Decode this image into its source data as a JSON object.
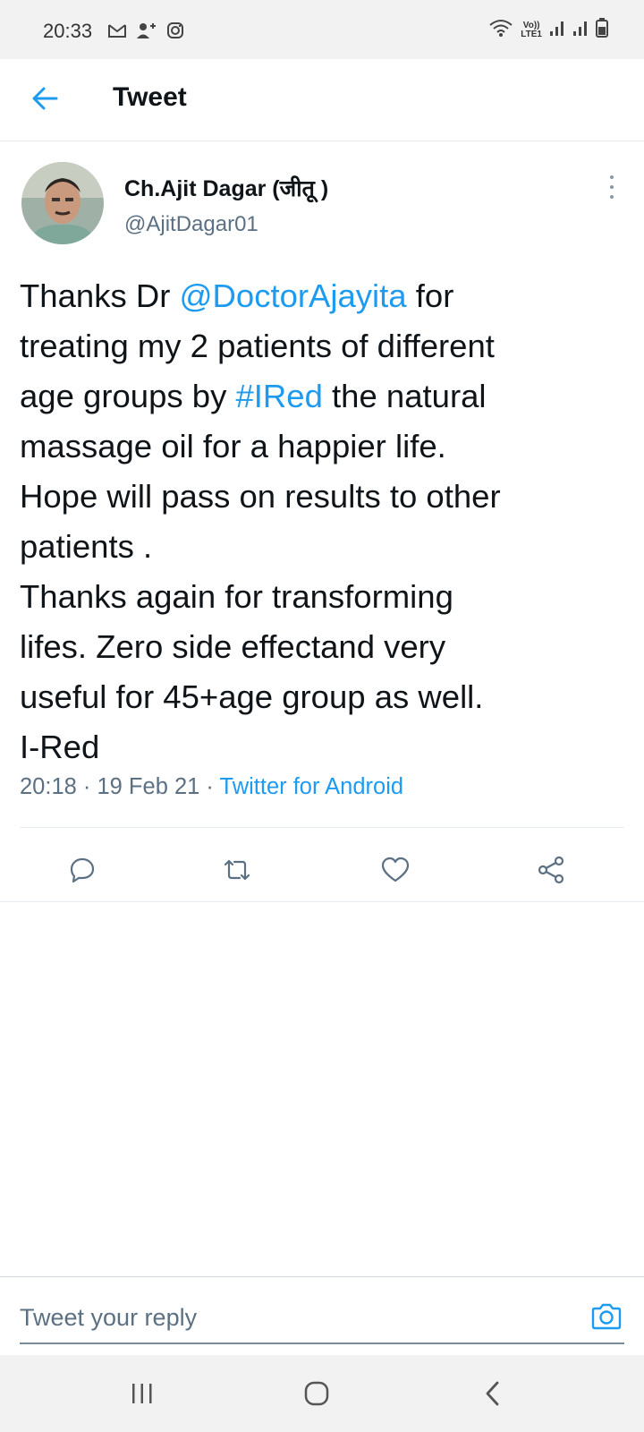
{
  "status_bar": {
    "time": "20:33",
    "left_icons": [
      "gmail-icon",
      "add-contact-icon",
      "instagram-icon"
    ],
    "volte_label": "Vo))\nLTE1",
    "right_icons": [
      "wifi-icon",
      "signal-icon",
      "signal-icon",
      "battery-icon"
    ]
  },
  "header": {
    "title": "Tweet",
    "back_icon": "back-arrow-icon"
  },
  "tweet": {
    "author_name": "Ch.Ajit Dagar (जीतू )",
    "author_handle": "@AjitDagar01",
    "text_parts": [
      {
        "text": "Thanks Dr ",
        "type": "plain"
      },
      {
        "text": "@DoctorAjayita",
        "type": "mention"
      },
      {
        "text": " for\ntreating my 2 patients of different\nage groups by ",
        "type": "plain"
      },
      {
        "text": "#IRed",
        "type": "hashtag"
      },
      {
        "text": " the natural\nmassage oil for a happier life.\nHope will pass on results to other\npatients .\nThanks again for transforming\nlifes. Zero side effectand very\nuseful for 45+age group as well.\nI-Red",
        "type": "plain"
      }
    ],
    "time": "20:18",
    "separator": " · ",
    "date": "19 Feb 21",
    "source": "Twitter for Android",
    "actions": [
      "reply-icon",
      "retweet-icon",
      "like-icon",
      "share-icon"
    ]
  },
  "reply": {
    "placeholder": "Tweet your reply",
    "camera_icon": "camera-icon"
  },
  "nav": [
    "recent-apps-icon",
    "home-icon",
    "back-icon"
  ],
  "colors": {
    "accent": "#1d9bf0",
    "secondary_text": "#5b7083",
    "status_bar_bg": "#f2f2f2"
  }
}
